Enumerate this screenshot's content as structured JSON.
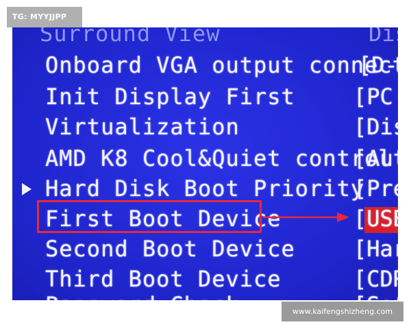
{
  "watermark_tag": "TG: MYYJJPP",
  "watermark_site": "www.kaifengshizheng.com",
  "menu": {
    "partial_top_label": "Surround View",
    "partial_top_value": "Dis",
    "items": [
      {
        "label": "Onboard VGA output connect",
        "value": "[D-S"
      },
      {
        "label": "Init Display First",
        "value": "[PC"
      },
      {
        "label": "Virtualization",
        "value": "[Dis"
      },
      {
        "label": "AMD K8 Cool&Quiet control",
        "value": "[Aut"
      },
      {
        "label": "Hard Disk Boot Priority",
        "value": "[Pre"
      },
      {
        "label": "First Boot Device",
        "value": "[",
        "value_highlight": "USB"
      },
      {
        "label": "Second Boot Device",
        "value": "[Har"
      },
      {
        "label": "Third Boot Device",
        "value": "[CDR"
      },
      {
        "label": "Password Check",
        "value": "[Set"
      }
    ]
  },
  "colors": {
    "bios_background": "#2228d6",
    "highlight_red": "#e8283a"
  }
}
